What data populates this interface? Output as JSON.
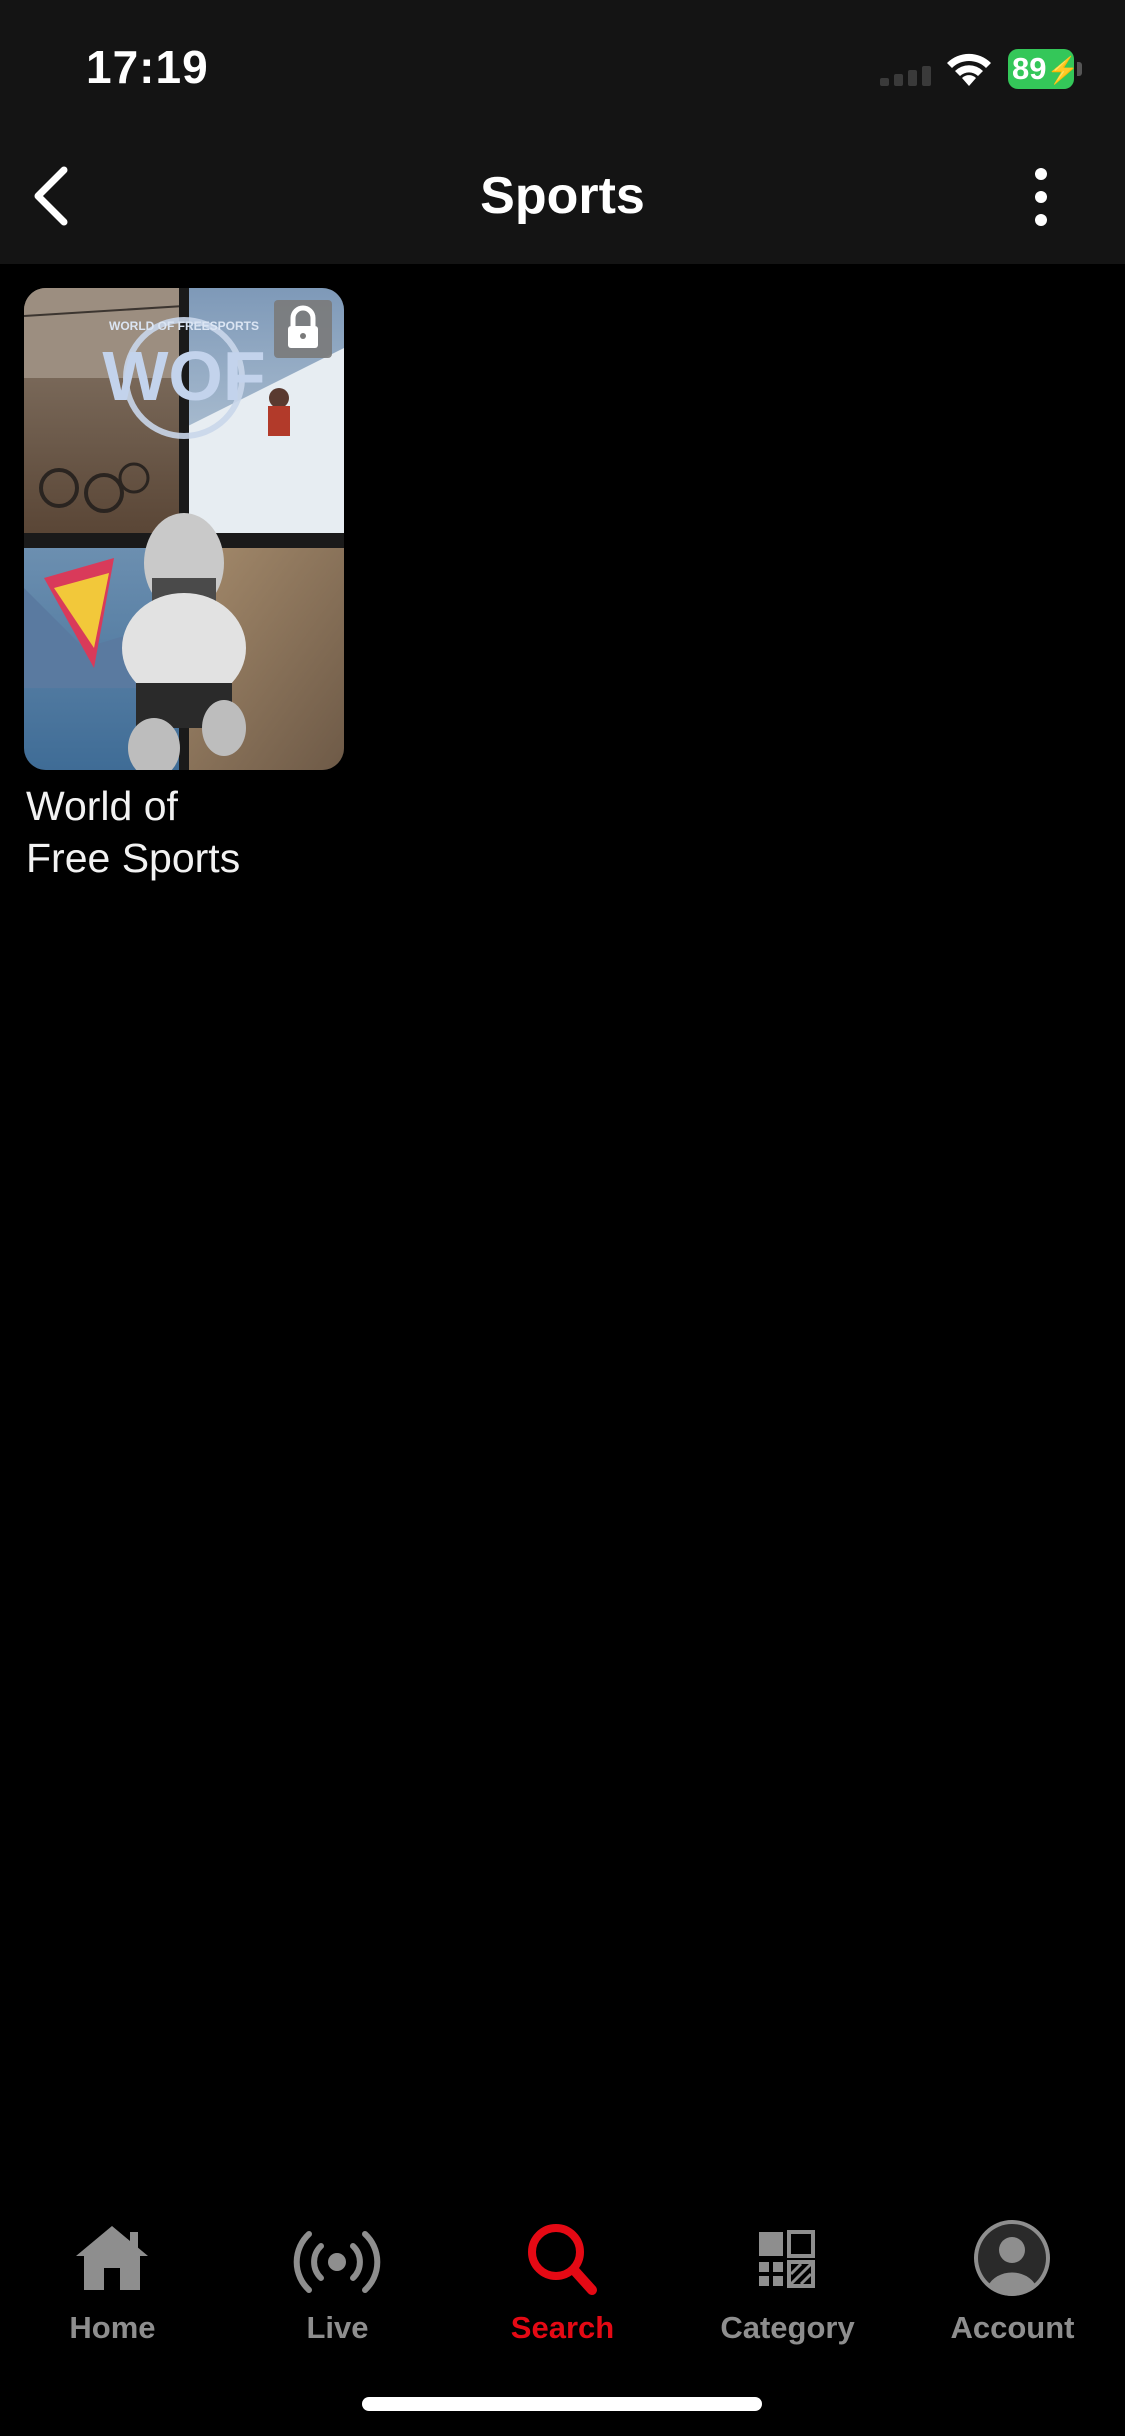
{
  "status_bar": {
    "time": "17:19",
    "battery": "89",
    "battery_color": "#34c759"
  },
  "nav": {
    "title": "Sports",
    "back_icon": "chevron-left-icon",
    "more_icon": "more-vertical-icon"
  },
  "content": {
    "items": [
      {
        "title": "World of\nFree Sports",
        "poster_logo": "WOF",
        "poster_logo_ring": "WORLD OF FREESPORTS",
        "locked": true
      }
    ]
  },
  "tab_bar": {
    "accent_color": "#e50914",
    "inactive_color": "#8e8e8e",
    "tabs": [
      {
        "label": "Home",
        "icon": "home-icon",
        "active": false
      },
      {
        "label": "Live",
        "icon": "live-broadcast-icon",
        "active": false
      },
      {
        "label": "Search",
        "icon": "search-icon",
        "active": true
      },
      {
        "label": "Category",
        "icon": "category-grid-icon",
        "active": false
      },
      {
        "label": "Account",
        "icon": "account-avatar-icon",
        "active": false
      }
    ]
  }
}
